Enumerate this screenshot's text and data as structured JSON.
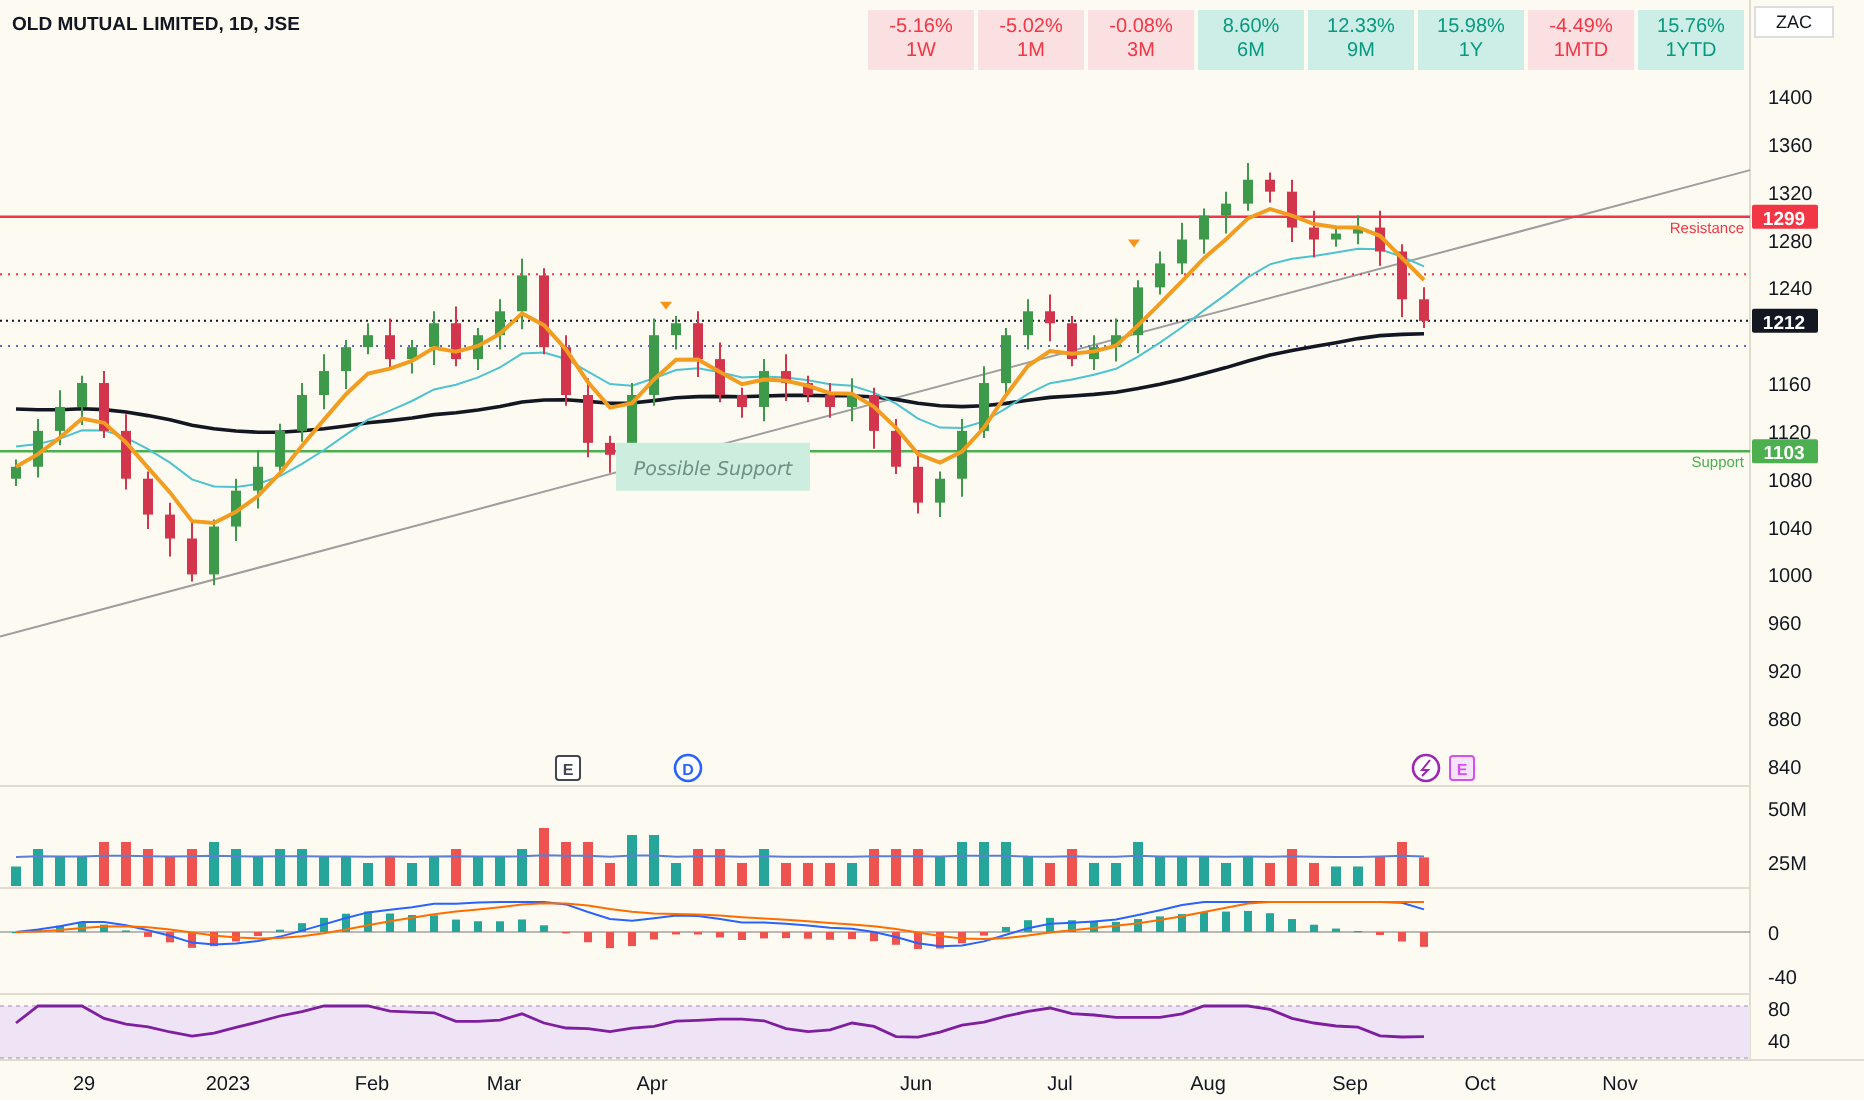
{
  "header": {
    "title": "OLD MUTUAL LIMITED, 1D, JSE",
    "currency": "ZAC"
  },
  "performance": [
    {
      "value": "-5.16%",
      "period": "1W",
      "kind": "loss"
    },
    {
      "value": "-5.02%",
      "period": "1M",
      "kind": "loss"
    },
    {
      "value": "-0.08%",
      "period": "3M",
      "kind": "loss"
    },
    {
      "value": "8.60%",
      "period": "6M",
      "kind": "gain"
    },
    {
      "value": "12.33%",
      "period": "9M",
      "kind": "gain"
    },
    {
      "value": "15.98%",
      "period": "1Y",
      "kind": "gain"
    },
    {
      "value": "-4.49%",
      "period": "1MTD",
      "kind": "loss"
    },
    {
      "value": "15.76%",
      "period": "1YTD",
      "kind": "gain"
    }
  ],
  "price_chart": {
    "price_axis": [
      "1400",
      "1360",
      "1320",
      "1280",
      "1240",
      "1160",
      "1120",
      "1080",
      "1040",
      "1000",
      "960",
      "920",
      "880",
      "840"
    ],
    "levels": [
      {
        "label": "Resistance",
        "tag": "1299",
        "color": "#f23645"
      },
      {
        "label": "Support",
        "tag": "1103",
        "color": "#4caf50"
      }
    ],
    "last_price": "1212",
    "note": "Possible Support",
    "events": [
      {
        "kind": "earnings",
        "text": "E"
      },
      {
        "kind": "dividend",
        "text": "D"
      },
      {
        "kind": "split"
      },
      {
        "kind": "upcoming",
        "text": "E"
      }
    ]
  },
  "volume": {
    "ticks": [
      "50M",
      "25M"
    ]
  },
  "macd": {
    "ticks": [
      "0",
      "-40"
    ]
  },
  "rsi": {
    "ticks": [
      "80",
      "40"
    ]
  },
  "time_axis": [
    "29",
    "2023",
    "Feb",
    "Mar",
    "Apr",
    "Jun",
    "Jul",
    "Aug",
    "Sep",
    "Oct",
    "Nov"
  ]
}
